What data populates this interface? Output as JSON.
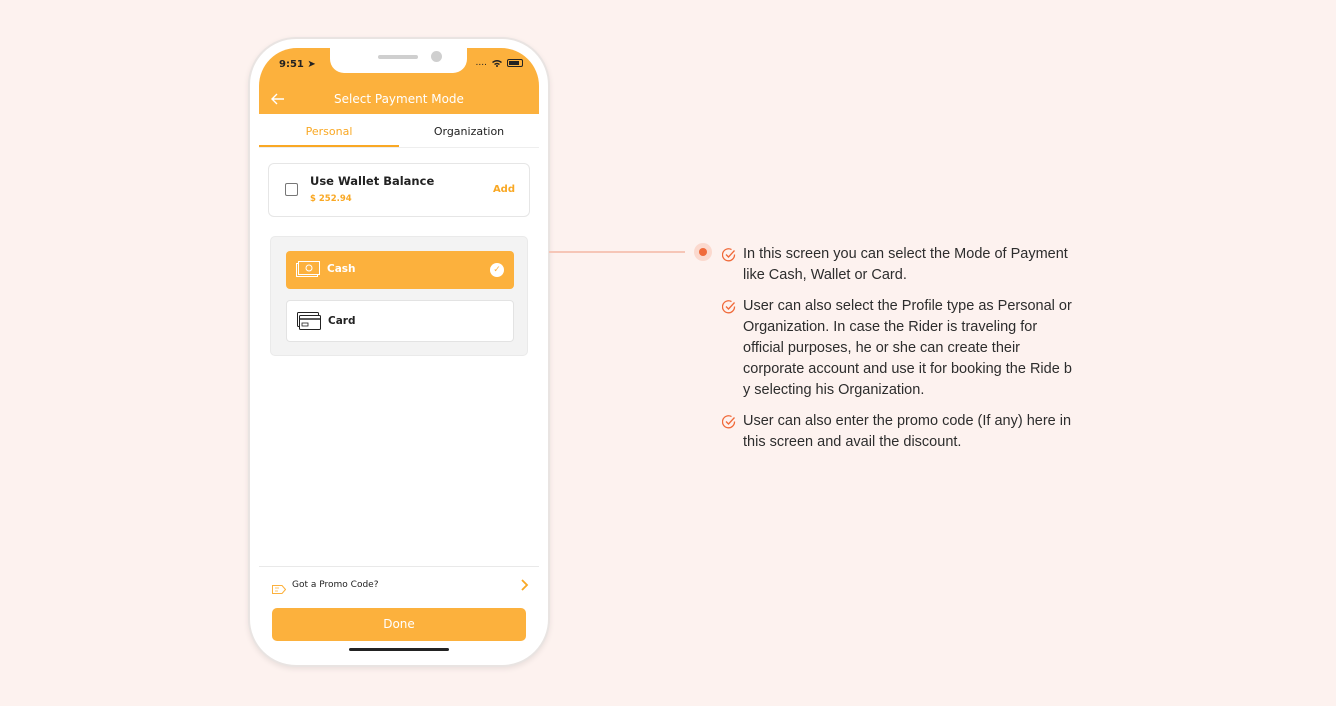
{
  "status_bar": {
    "time": "9:51",
    "signal": "...."
  },
  "nav": {
    "back_icon": "back-arrow-icon",
    "title": "Select Payment Mode"
  },
  "tabs": [
    {
      "label": "Personal",
      "active": true
    },
    {
      "label": "Organization",
      "active": false
    }
  ],
  "wallet": {
    "title": "Use Wallet Balance",
    "amount": "$ 252.94",
    "add_label": "Add",
    "checked": false
  },
  "payment_options": [
    {
      "label": "Cash",
      "icon": "cash-icon",
      "selected": true
    },
    {
      "label": "Card",
      "icon": "card-icon",
      "selected": false
    }
  ],
  "promo": {
    "label": "Got a Promo Code?",
    "icon": "tag-icon"
  },
  "done_label": "Done",
  "bullets": [
    "In this screen you can select the Mode of Payment like Cash, Wallet or Card.",
    "User can also select the Profile type as Personal or Organization. In case the Rider is traveling for official purposes, he or she can create their corporate account and use it for booking the Ride b y selecting his Organization.",
    "User can also enter the promo code (If any) here in this screen and avail the discount."
  ],
  "colors": {
    "accent": "#fcb13d",
    "background": "#fdf2ef",
    "highlight": "#f06a3a"
  }
}
